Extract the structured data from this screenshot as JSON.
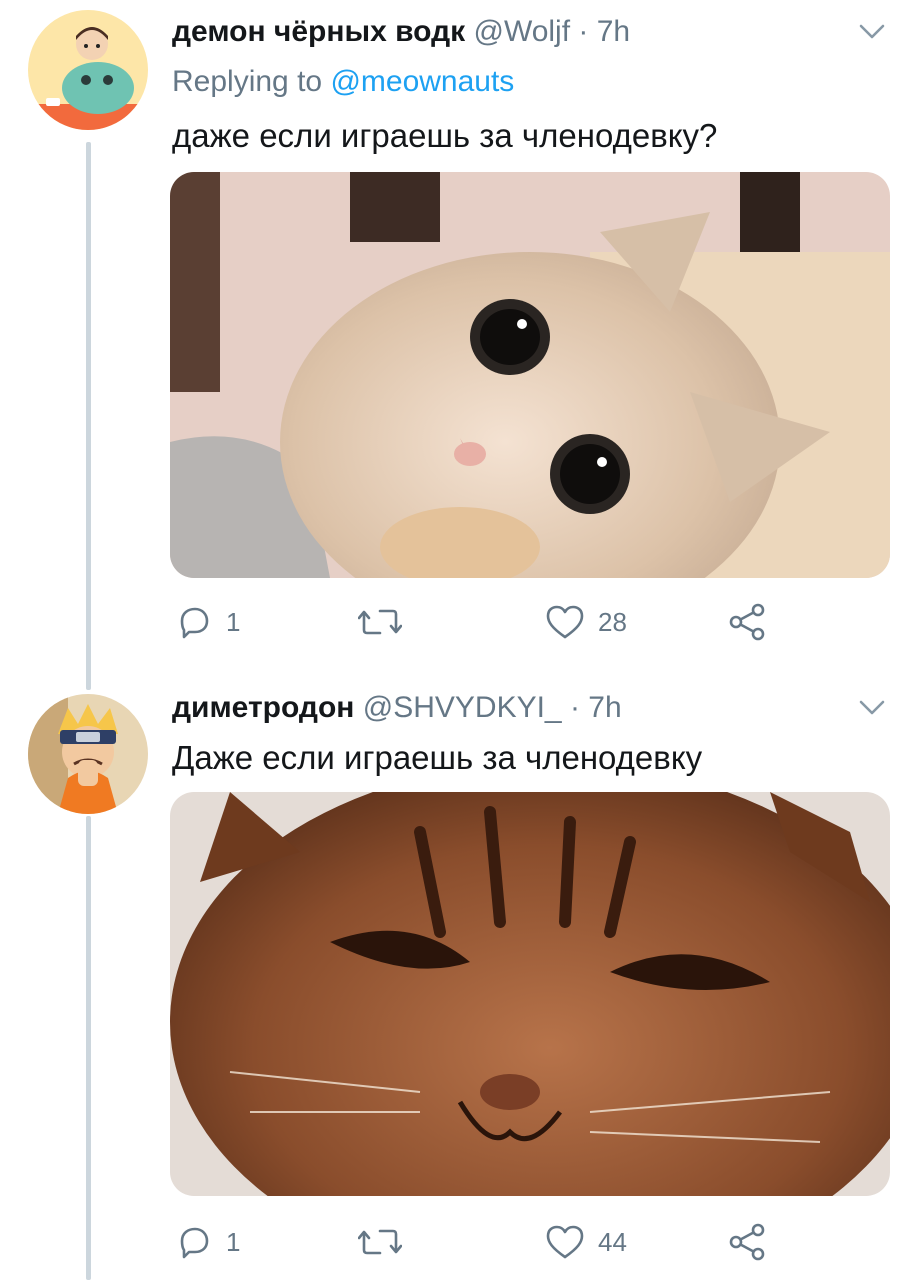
{
  "tweets": [
    {
      "display_name": "демон чёрных водк",
      "handle": "@Woljf",
      "time": "7h",
      "reply_prefix": "Replying to",
      "reply_handle": "@meownauts",
      "text": "даже если играешь за членодевку?",
      "replies": "1",
      "retweets": "",
      "likes": "28"
    },
    {
      "display_name": "диметродон",
      "handle": "@SHVYDKYI_",
      "time": "7h",
      "text": "Даже если играешь за членодевку",
      "replies": "1",
      "retweets": "",
      "likes": "44"
    }
  ],
  "colors": {
    "text": "#14171a",
    "secondary": "#657786",
    "link": "#1da1f2",
    "thread_line": "#ccd6dd"
  },
  "icons": [
    "caret-down-icon",
    "reply-icon",
    "retweet-icon",
    "like-icon",
    "share-icon"
  ]
}
